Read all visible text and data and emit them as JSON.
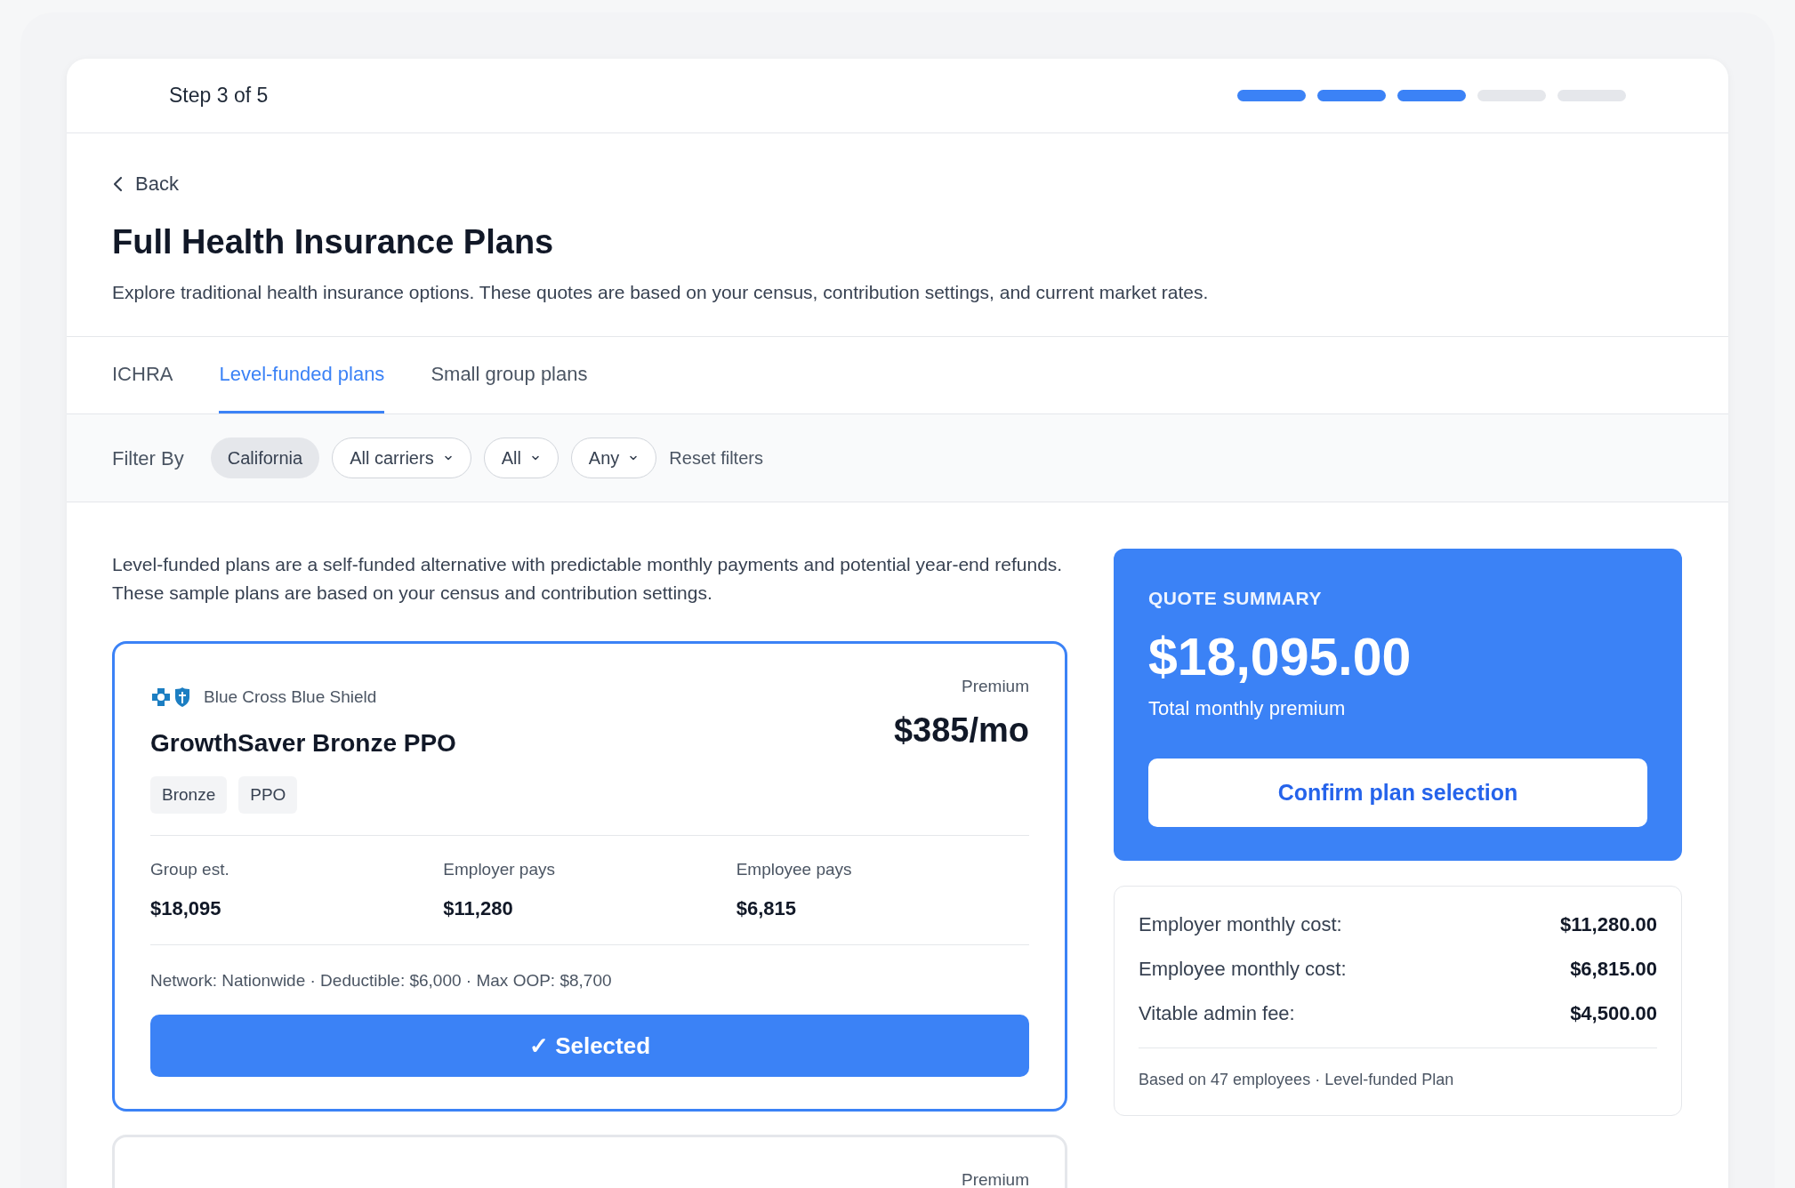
{
  "step": {
    "label": "Step 3 of 5",
    "progress": [
      {
        "complete": true
      },
      {
        "complete": true
      },
      {
        "complete": true
      },
      {
        "complete": false
      },
      {
        "complete": false
      }
    ]
  },
  "back": "Back",
  "title": "Full Health Insurance Plans",
  "description": "Explore traditional health insurance options. These quotes are based on your census, contribution settings, and current market rates.",
  "tabs": [
    {
      "label": "ICHRA",
      "selected": false
    },
    {
      "label": "Level-funded plans",
      "selected": true
    },
    {
      "label": "Small group plans",
      "selected": false
    }
  ],
  "filters": {
    "label": "Filter By",
    "items": [
      {
        "kind": "chip",
        "label": "California"
      },
      {
        "kind": "dropdown",
        "label": "All carriers"
      },
      {
        "kind": "dropdown",
        "label": "All"
      },
      {
        "kind": "dropdown",
        "label": "Any"
      },
      {
        "kind": "link",
        "label": "Reset filters"
      }
    ]
  },
  "intro": "Level-funded plans are a self-funded alternative with predictable monthly payments and potential year-end refunds. These sample plans are based on your census and contribution settings.",
  "plans": [
    {
      "selected": true,
      "carrier": "Blue Cross Blue Shield",
      "name": "GrowthSaver Bronze PPO",
      "premium_label": "Premium",
      "premium": "$385/mo",
      "tags": [
        "Bronze",
        "PPO"
      ],
      "stats": [
        {
          "label": "Group est.",
          "value": "$18,095"
        },
        {
          "label": "Employer pays",
          "value": "$11,280"
        },
        {
          "label": "Employee pays",
          "value": "$6,815"
        }
      ],
      "details": "Network: Nationwide · Deductible: $6,000 · Max OOP: $8,700",
      "button": "✓ Selected"
    },
    {
      "selected": false,
      "premium_label": "Premium"
    }
  ],
  "summary": {
    "heading": "QUOTE SUMMARY",
    "total": "$18,095.00",
    "total_label": "Total monthly premium",
    "button": "Confirm plan selection"
  },
  "costs": {
    "rows": [
      {
        "label": "Employer monthly cost:",
        "value": "$11,280.00"
      },
      {
        "label": "Employee monthly cost:",
        "value": "$6,815.00"
      },
      {
        "label": "Vitable admin fee:",
        "value": "$4,500.00"
      }
    ],
    "footnote": "Based on 47 employees · Level-funded Plan"
  }
}
